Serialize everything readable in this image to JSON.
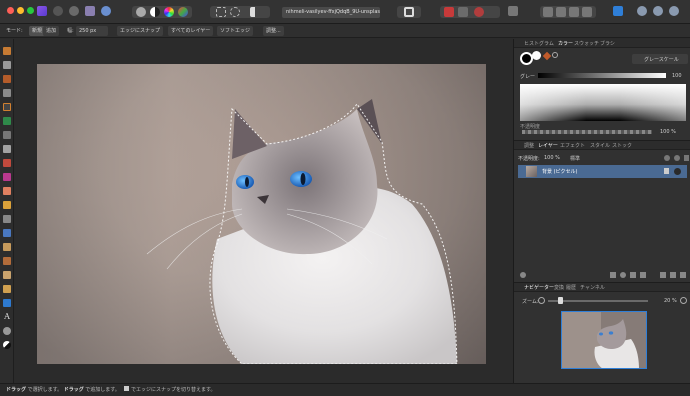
{
  "document": {
    "tab_title": "nihmeli-vasilyev-ffxjQdqB_9U-unsplas ×"
  },
  "context_toolbar": {
    "mode_label": "モード:",
    "mode_new": "新規",
    "mode_add": "追加",
    "width_label": "幅:",
    "width_value": "250 px",
    "snap_edges": "エッジにスナップ",
    "all_layers": "すべてのレイヤー",
    "soft_edges": "ソフトエッジ",
    "refine": "調整..."
  },
  "status_bar": {
    "drag1": "ドラッグ",
    "text1": " で選択します。",
    "drag2": "ドラッグ",
    "text2": " で追加します。",
    "text3": " でエッジにスナップを切り替えます。"
  },
  "color_panel": {
    "tabs": [
      "ヒストグラム",
      "カラー",
      "スウォッチ",
      "ブラシ"
    ],
    "active_tab": 1,
    "mode": "グレースケール",
    "gray_label": "グレー",
    "gray_value": "100",
    "opacity_label": "不透明度",
    "opacity_value": "100 %"
  },
  "layers_panel": {
    "tabs": [
      "調整",
      "レイヤー",
      "エフェクト",
      "スタイル",
      "ストック"
    ],
    "active_tab": 1,
    "opacity_label": "不透明度:",
    "opacity_value": "100 %",
    "blend_mode": "標準",
    "layer_name": "背景 (ピクセル)"
  },
  "navigator_panel": {
    "tabs": [
      "ナビゲーター",
      "変換",
      "履歴",
      "チャンネル"
    ],
    "active_tab": 0,
    "zoom_label": "ズーム:",
    "zoom_value": "20 %"
  },
  "colors": {
    "layer_selected": "#4a6a93",
    "accent_blue": "#2f7fd8"
  }
}
